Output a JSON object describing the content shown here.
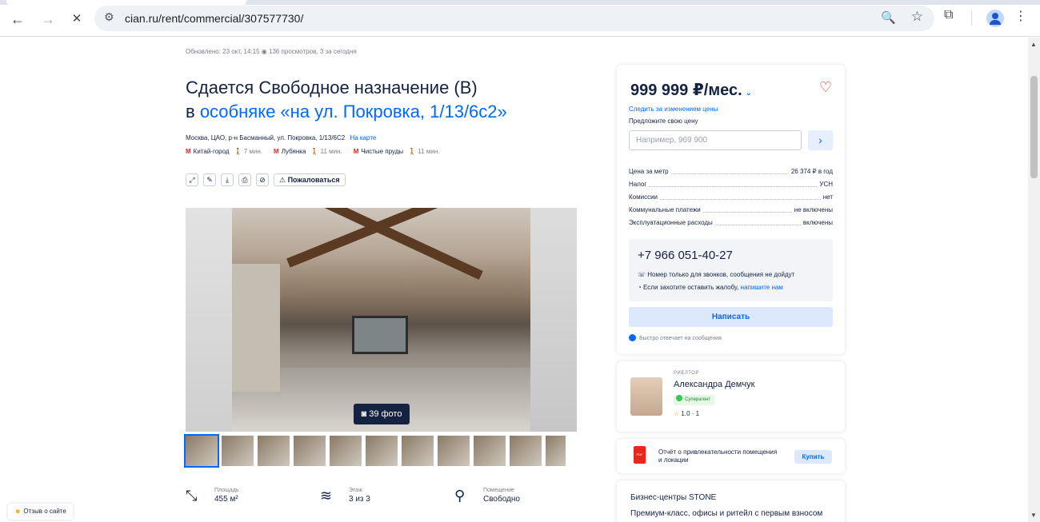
{
  "browser": {
    "url": "cian.ru/rent/commercial/307577730/",
    "back_icon": "←",
    "forward_icon": "→",
    "close_icon": "✕",
    "site_settings_icon": "⚙",
    "zoom_icon": "🔍",
    "star_icon": "☆",
    "extensions_icon": "⧉",
    "menu_icon": "⋮"
  },
  "listing": {
    "meta": "Обновлено: 23 окт, 14:15   ◉ 136 просмотров, 3 за сегодня",
    "title_line1": "Сдается Свободное назначение (В)",
    "title_line2_prefix": "в ",
    "title_line2_link": "особняке «на ул. Покровка, 1/13/6с2»",
    "address": "Москва, ЦАО, р-н Басманный, ул. Покровка, 1/13/6С2",
    "map_link": "На карте",
    "metro": [
      {
        "name": "Китай-город",
        "walk": "7 мин."
      },
      {
        "name": "Лубянка",
        "walk": "11 мин."
      },
      {
        "name": "Чистые пруды",
        "walk": "11 мин."
      }
    ],
    "actions": {
      "share": "⤢",
      "edit": "✎",
      "download": "⤓",
      "print": "⎙",
      "hide": "⊘",
      "complain": "⚠ Пожаловаться"
    },
    "photo_count": "◙ 39 фото",
    "thumbnails_count": 11,
    "props": [
      {
        "label": "Площадь",
        "value": "455 м²",
        "icon": "⤡"
      },
      {
        "label": "Этаж",
        "value": "3 из 3",
        "icon": "≋"
      },
      {
        "label": "Помещение",
        "value": "Свободно",
        "icon": "⚲"
      }
    ]
  },
  "price_card": {
    "price": "999 999 ₽/мес.",
    "price_dropdown": "⌄",
    "favorite_icon": "♡",
    "follow_price": "Следить за изменением цены",
    "offer_label": "Предложите свою цену",
    "offer_placeholder": "Например, 969 900",
    "offer_submit": "›",
    "details": [
      {
        "key": "Цена за метр",
        "value": "26 374 ₽ в год"
      },
      {
        "key": "Налог",
        "value": "УСН"
      },
      {
        "key": "Комиссии",
        "value": "нет"
      },
      {
        "key": "Коммунальные платежи",
        "value": "не включены"
      },
      {
        "key": "Эксплуатационные расходы",
        "value": "включены"
      }
    ],
    "phone": "+7 966 051-40-27",
    "phone_note": "☏  Номер только для звонков, сообщения не дойдут",
    "complaint_note": "◔  Если захотите оставить жалобу, ",
    "complaint_link": "напишите нам",
    "write_button": "Написать",
    "fast_reply": "Быстро отвечает на сообщения"
  },
  "agent": {
    "role": "РИЕЛТОР",
    "name": "Александра Демчук",
    "badge": "Суперагент",
    "rating_star": "☆",
    "rating": "1.0 · 1"
  },
  "report": {
    "icon": "PDF",
    "text": "Отчёт о привлекательности помещения и локации",
    "buy": "Купить"
  },
  "ad": {
    "title": "Бизнес-центры STONE",
    "text": "Премиум-класс, офисы и ритейл с первым взносом"
  },
  "feedback": {
    "icon": "☻",
    "label": "Отзыв о сайте"
  },
  "colors": {
    "accent": "#0468ff",
    "text": "#152242",
    "metro_red": "#e8261d"
  }
}
